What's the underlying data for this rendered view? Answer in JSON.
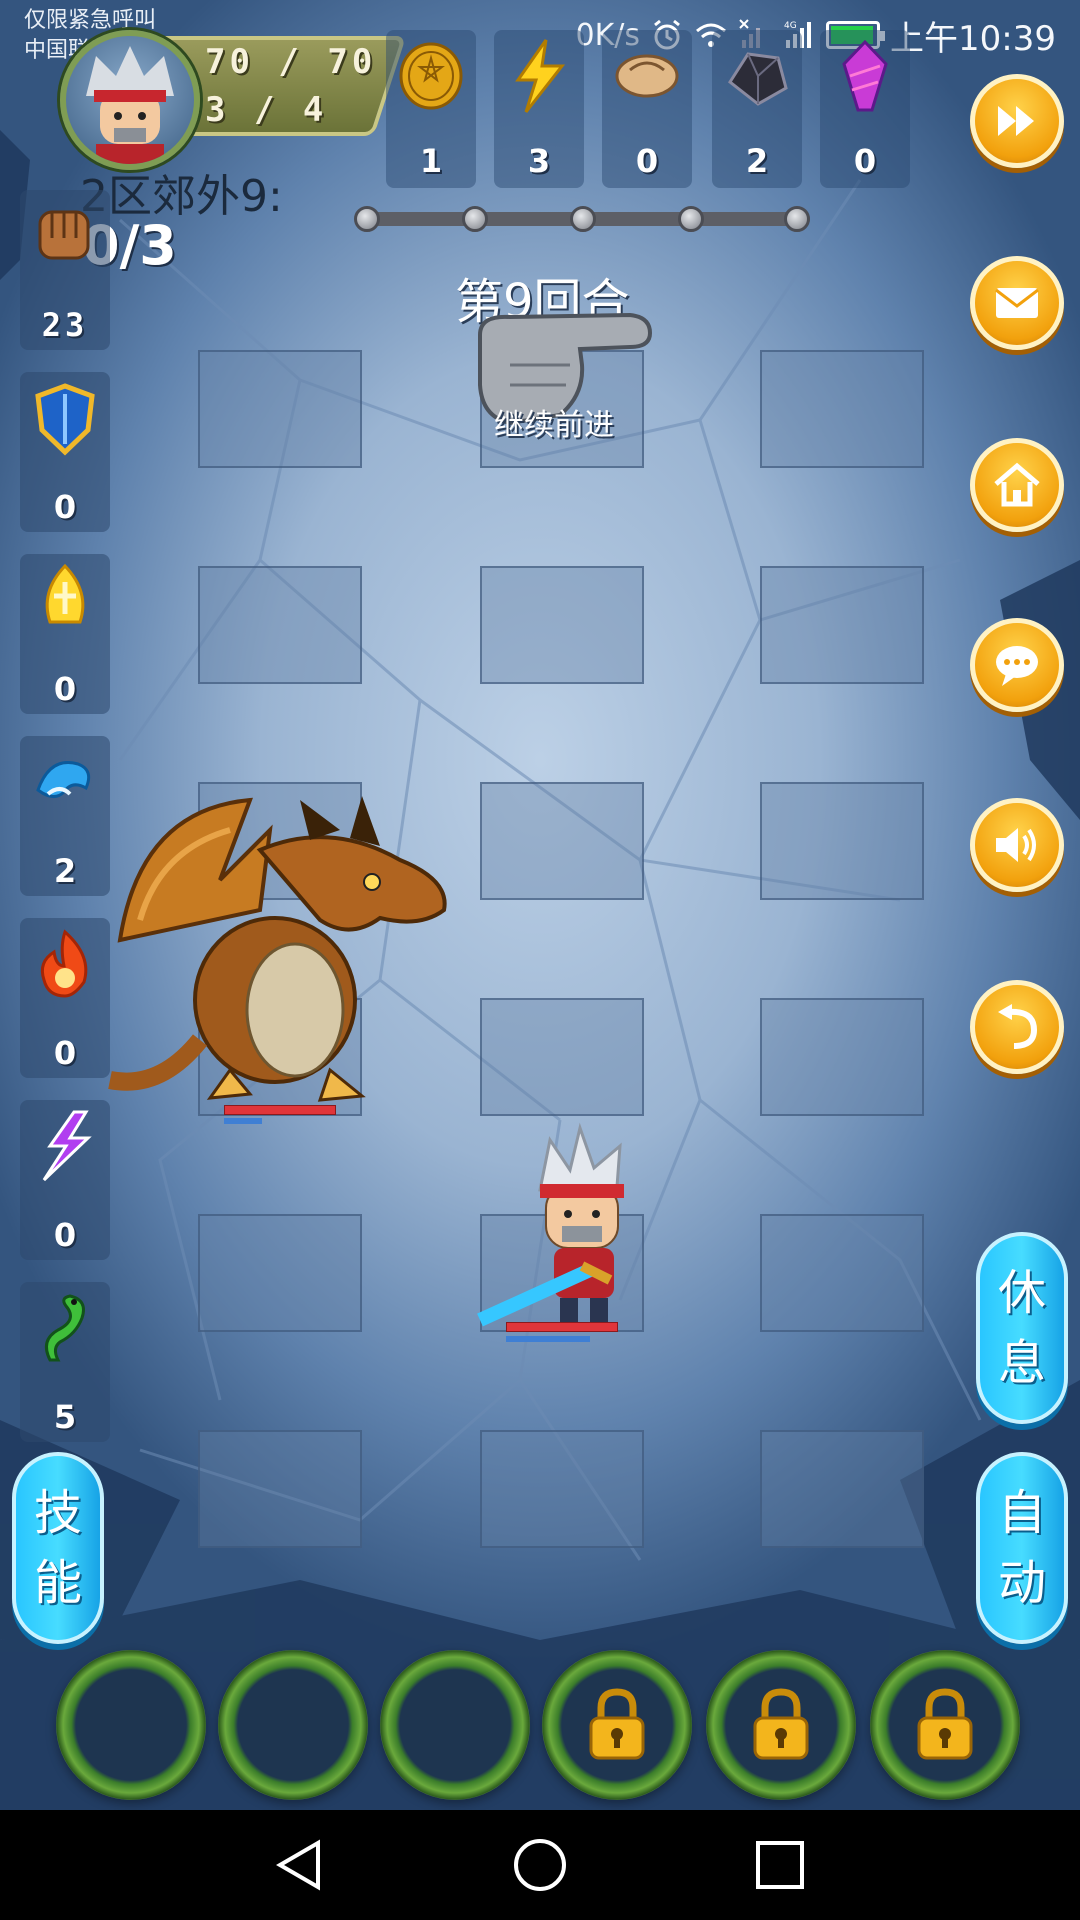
{
  "status_bar": {
    "carrier_line1": "仅限紧急呼叫",
    "carrier_line2": "中国联通",
    "net_speed": "0K/s",
    "network": "4G",
    "time": "上午10:39"
  },
  "hero": {
    "hp": "70 / 70",
    "ap": "3 / 4"
  },
  "resources": [
    {
      "icon": "gold-coin-icon",
      "count": "1"
    },
    {
      "icon": "lightning-icon",
      "count": "3"
    },
    {
      "icon": "bread-icon",
      "count": "0"
    },
    {
      "icon": "ore-icon",
      "count": "2"
    },
    {
      "icon": "crystal-icon",
      "count": "0"
    }
  ],
  "stage": {
    "title": "2区郊外9:",
    "progress": "0/3",
    "round": "第9回合",
    "continue_hint": "继续前进"
  },
  "items": [
    {
      "icon": "fist-icon",
      "count": "23"
    },
    {
      "icon": "shield-icon",
      "count": "0"
    },
    {
      "icon": "holy-flame-icon",
      "count": "0"
    },
    {
      "icon": "water-wave-icon",
      "count": "2"
    },
    {
      "icon": "fire-icon",
      "count": "0"
    },
    {
      "icon": "lightning-rune-icon",
      "count": "0"
    },
    {
      "icon": "poison-snake-icon",
      "count": "5"
    }
  ],
  "right_buttons": [
    {
      "name": "fast-forward-button",
      "icon": "fast-forward-icon"
    },
    {
      "name": "mail-button",
      "icon": "mail-icon"
    },
    {
      "name": "home-button",
      "icon": "home-icon"
    },
    {
      "name": "chat-button",
      "icon": "chat-icon"
    },
    {
      "name": "sound-button",
      "icon": "speaker-icon"
    },
    {
      "name": "back-button",
      "icon": "return-icon"
    }
  ],
  "side_buttons": {
    "rest_line1": "休",
    "rest_line2": "息",
    "auto_line1": "自",
    "auto_line2": "动",
    "skill_line1": "技",
    "skill_line2": "能"
  },
  "skill_slots": [
    {
      "locked": false
    },
    {
      "locked": false
    },
    {
      "locked": false
    },
    {
      "locked": true
    },
    {
      "locked": true
    },
    {
      "locked": true
    }
  ],
  "colors": {
    "accent_orange": "#f2a10d",
    "accent_cyan": "#29c6ff",
    "hp_red": "#e0353a",
    "mp_blue": "#3f7fd4"
  }
}
